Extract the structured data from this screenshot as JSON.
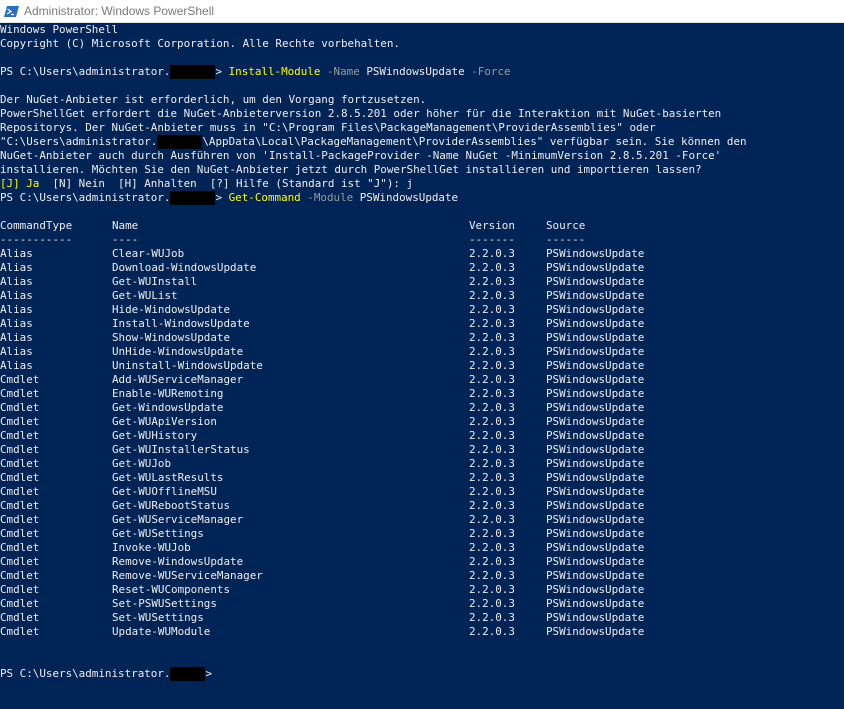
{
  "window": {
    "title": "Administrator: Windows PowerShell",
    "icon": "powershell-icon"
  },
  "colors": {
    "background": "#012456",
    "text": "#eeedf0",
    "command": "#fffa00",
    "parameter": "#9a9a9a",
    "redaction": "#000000"
  },
  "banner": {
    "line1": "Windows PowerShell",
    "line2": "Copyright (C) Microsoft Corporation. Alle Rechte vorbehalten."
  },
  "prompt1": {
    "prefix": "PS C:\\Users\\administrator.",
    "suffix": "> ",
    "command": "Install-Module",
    "param1": " -Name ",
    "arg1": "PSWindowsUpdate",
    "param2": " -Force"
  },
  "nuget": {
    "line1": "Der NuGet-Anbieter ist erforderlich, um den Vorgang fortzusetzen.",
    "line2": "PowerShellGet erfordert die NuGet-Anbieterversion 2.8.5.201 oder höher für die Interaktion mit NuGet-basierten",
    "line3": "Repositorys. Der NuGet-Anbieter muss in \"C:\\Program Files\\PackageManagement\\ProviderAssemblies\" oder",
    "line4a": "\"C:\\Users\\administrator.",
    "line4b": "\\AppData\\Local\\PackageManagement\\ProviderAssemblies\" verfügbar sein. Sie können den",
    "line5": "NuGet-Anbieter auch durch Ausführen von 'Install-PackageProvider -Name NuGet -MinimumVersion 2.8.5.201 -Force'",
    "line6": "installieren. Möchten Sie den NuGet-Anbieter jetzt durch PowerShellGet installieren und importieren lassen?",
    "choice_default": "[J] Ja",
    "choice_rest": "  [N] Nein  [H] Anhalten  [?] Hilfe (Standard ist \"J\"): j"
  },
  "prompt2": {
    "prefix": "PS C:\\Users\\administrator.",
    "suffix": "> ",
    "command": "Get-Command",
    "param1": " -Module ",
    "arg1": "PSWindowsUpdate"
  },
  "table": {
    "headers": [
      "CommandType",
      "Name",
      "Version",
      "Source"
    ],
    "separators": [
      "-----------",
      "----",
      "-------",
      "------"
    ],
    "rows": [
      [
        "Alias",
        "Clear-WUJob",
        "2.2.0.3",
        "PSWindowsUpdate"
      ],
      [
        "Alias",
        "Download-WindowsUpdate",
        "2.2.0.3",
        "PSWindowsUpdate"
      ],
      [
        "Alias",
        "Get-WUInstall",
        "2.2.0.3",
        "PSWindowsUpdate"
      ],
      [
        "Alias",
        "Get-WUList",
        "2.2.0.3",
        "PSWindowsUpdate"
      ],
      [
        "Alias",
        "Hide-WindowsUpdate",
        "2.2.0.3",
        "PSWindowsUpdate"
      ],
      [
        "Alias",
        "Install-WindowsUpdate",
        "2.2.0.3",
        "PSWindowsUpdate"
      ],
      [
        "Alias",
        "Show-WindowsUpdate",
        "2.2.0.3",
        "PSWindowsUpdate"
      ],
      [
        "Alias",
        "UnHide-WindowsUpdate",
        "2.2.0.3",
        "PSWindowsUpdate"
      ],
      [
        "Alias",
        "Uninstall-WindowsUpdate",
        "2.2.0.3",
        "PSWindowsUpdate"
      ],
      [
        "Cmdlet",
        "Add-WUServiceManager",
        "2.2.0.3",
        "PSWindowsUpdate"
      ],
      [
        "Cmdlet",
        "Enable-WURemoting",
        "2.2.0.3",
        "PSWindowsUpdate"
      ],
      [
        "Cmdlet",
        "Get-WindowsUpdate",
        "2.2.0.3",
        "PSWindowsUpdate"
      ],
      [
        "Cmdlet",
        "Get-WUApiVersion",
        "2.2.0.3",
        "PSWindowsUpdate"
      ],
      [
        "Cmdlet",
        "Get-WUHistory",
        "2.2.0.3",
        "PSWindowsUpdate"
      ],
      [
        "Cmdlet",
        "Get-WUInstallerStatus",
        "2.2.0.3",
        "PSWindowsUpdate"
      ],
      [
        "Cmdlet",
        "Get-WUJob",
        "2.2.0.3",
        "PSWindowsUpdate"
      ],
      [
        "Cmdlet",
        "Get-WULastResults",
        "2.2.0.3",
        "PSWindowsUpdate"
      ],
      [
        "Cmdlet",
        "Get-WUOfflineMSU",
        "2.2.0.3",
        "PSWindowsUpdate"
      ],
      [
        "Cmdlet",
        "Get-WURebootStatus",
        "2.2.0.3",
        "PSWindowsUpdate"
      ],
      [
        "Cmdlet",
        "Get-WUServiceManager",
        "2.2.0.3",
        "PSWindowsUpdate"
      ],
      [
        "Cmdlet",
        "Get-WUSettings",
        "2.2.0.3",
        "PSWindowsUpdate"
      ],
      [
        "Cmdlet",
        "Invoke-WUJob",
        "2.2.0.3",
        "PSWindowsUpdate"
      ],
      [
        "Cmdlet",
        "Remove-WindowsUpdate",
        "2.2.0.3",
        "PSWindowsUpdate"
      ],
      [
        "Cmdlet",
        "Remove-WUServiceManager",
        "2.2.0.3",
        "PSWindowsUpdate"
      ],
      [
        "Cmdlet",
        "Reset-WUComponents",
        "2.2.0.3",
        "PSWindowsUpdate"
      ],
      [
        "Cmdlet",
        "Set-PSWUSettings",
        "2.2.0.3",
        "PSWindowsUpdate"
      ],
      [
        "Cmdlet",
        "Set-WUSettings",
        "2.2.0.3",
        "PSWindowsUpdate"
      ],
      [
        "Cmdlet",
        "Update-WUModule",
        "2.2.0.3",
        "PSWindowsUpdate"
      ]
    ]
  },
  "prompt3": {
    "prefix": "PS C:\\Users\\administrator.",
    "suffix": ">"
  }
}
